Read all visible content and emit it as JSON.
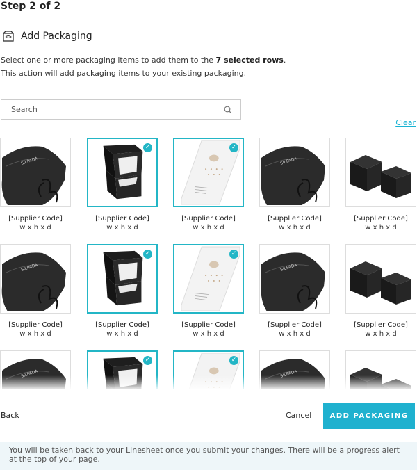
{
  "step": "Step 2 of 2",
  "heading": {
    "title": "Add Packaging",
    "icon": "packaging-icon"
  },
  "description": {
    "line1_prefix": "Select one or more packaging items to add them to the ",
    "line1_bold": "7 selected rows",
    "line1_suffix": ".",
    "line2": "This action will add packaging items to your existing packaging."
  },
  "search": {
    "placeholder": "Search",
    "value": ""
  },
  "clear_label": "Clear",
  "columns": [
    {
      "type": "pouch",
      "selected": false,
      "code": "[Supplier Code]",
      "dims": "w x h x d"
    },
    {
      "type": "ringbox",
      "selected": true,
      "code": "[Supplier Code]",
      "dims": "w x h x d"
    },
    {
      "type": "card",
      "selected": true,
      "code": "[Supplier Code]",
      "dims": "w x h x d"
    },
    {
      "type": "pouch",
      "selected": false,
      "code": "[Supplier Code]",
      "dims": "w x h x d"
    },
    {
      "type": "boxes",
      "selected": false,
      "code": "[Supplier Code]",
      "dims": "w x h x d"
    }
  ],
  "footer": {
    "back": "Back",
    "cancel": "Cancel",
    "add": "ADD PACKAGING"
  },
  "notice": "You will be taken back to your Linesheet once you submit your changes. There will be a progress alert at the top of your page.",
  "colors": {
    "accent": "#1fb1cf",
    "selected_border": "#23b6c6",
    "notice_bg": "#eef6f9"
  }
}
